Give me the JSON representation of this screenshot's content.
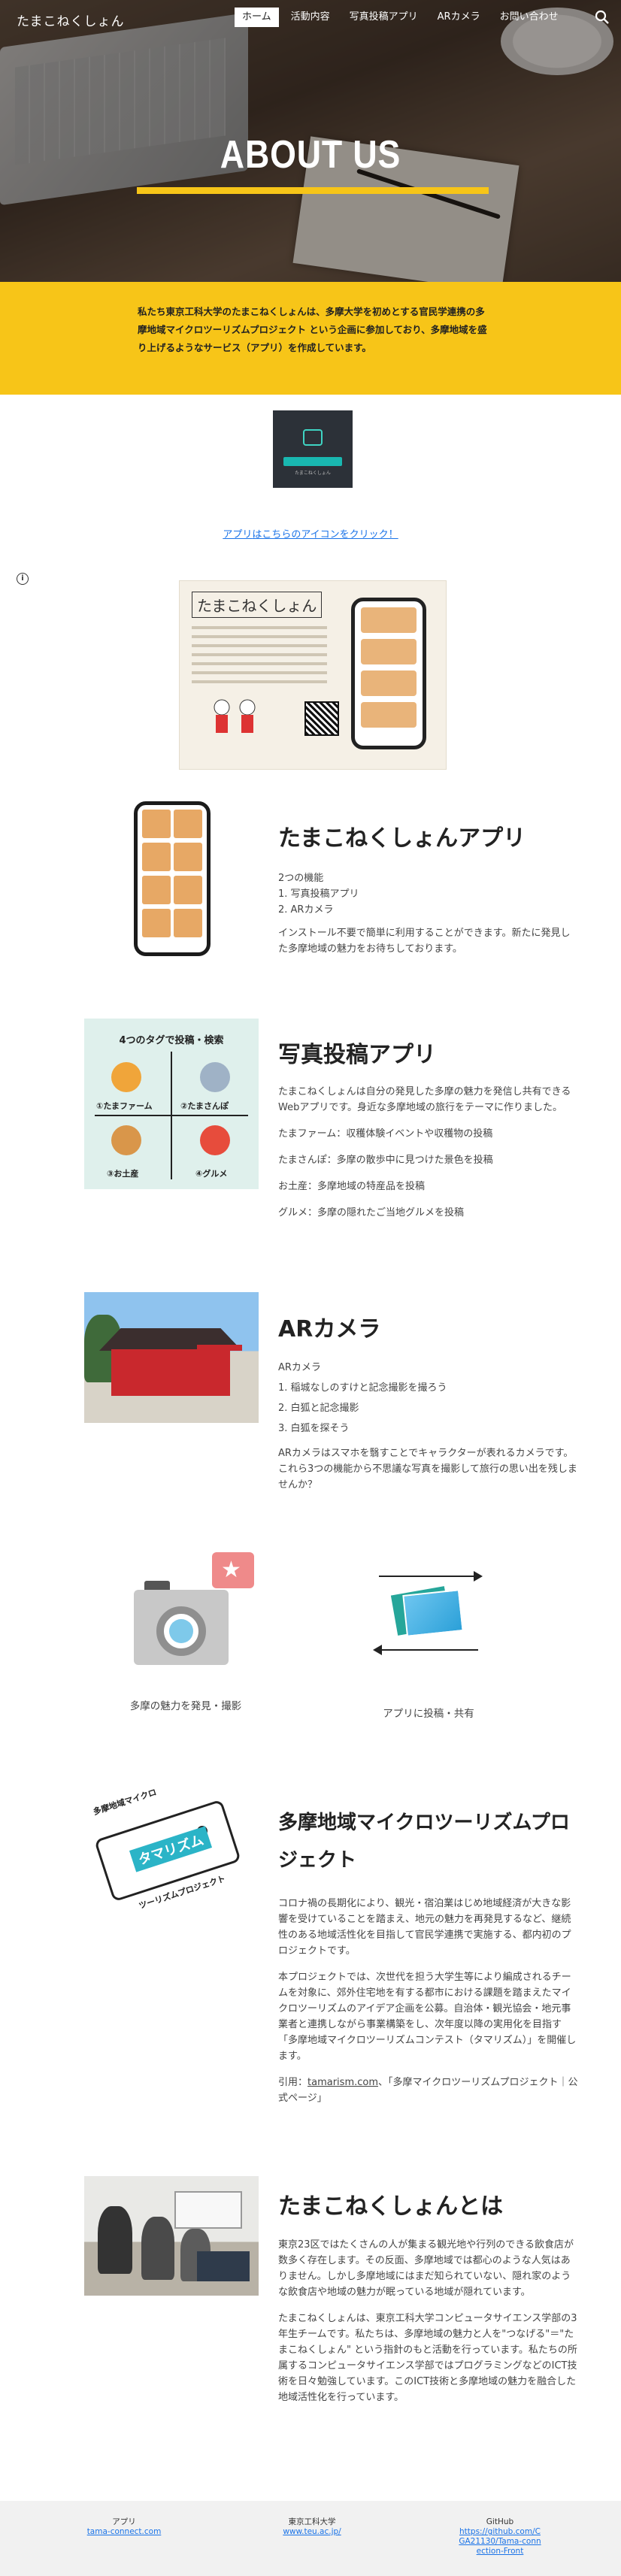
{
  "header": {
    "site_title": "たまこねくしょん",
    "nav": [
      "ホーム",
      "活動内容",
      "写真投稿アプリ",
      "ARカメラ",
      "お問い合わせ"
    ]
  },
  "hero": {
    "title": "ABOUT US"
  },
  "intro": {
    "text": "私たち東京工科大学のたまこねくしょんは、多摩大学を初めとする官民学連携の多摩地域マイクロツーリズムプロジェクト という企画に参加しており、多摩地域を盛り上げるようなサービス（アプリ）を作成しています。"
  },
  "app_icon": {
    "label": "たまこねくしょん"
  },
  "app_link": {
    "underlined": "アプリ",
    "rest": "はこちらのアイコンをクリック！"
  },
  "flyer": {
    "title": "たまこねくしょん"
  },
  "sections": {
    "app": {
      "title": "たまこねくしょんアプリ",
      "lines": [
        "2つの機能",
        "1. 写真投稿アプリ",
        "2. ARカメラ"
      ],
      "desc": "インストール不要で簡単に利用することができます。新たに発見した多摩地域の魅力をお待ちしております。"
    },
    "photo": {
      "title": "写真投稿アプリ",
      "image_title": "4つのタグで投稿・検索",
      "tag_captions": [
        "①たまファーム",
        "②たまさんぽ",
        "③お土産",
        "④グルメ"
      ],
      "paragraphs": [
        "たまこねくしょんは自分の発見した多摩の魅力を発信し共有できるWebアプリです。身近な多摩地域の旅行をテーマに作りました。",
        "たまファーム：収穫体験イベントや収穫物の投稿",
        "たまさんぽ：多摩の散歩中に見つけた景色を投稿",
        "お土産：多摩地域の特産品を投稿",
        "グルメ：多摩の隠れたご当地グルメを投稿"
      ]
    },
    "ar": {
      "title": "ARカメラ",
      "lines": [
        "ARカメラ",
        "1. 稲城なしのすけと記念撮影を撮ろう",
        "2. 白狐と記念撮影",
        "3. 白狐を探そう"
      ],
      "desc": "ARカメラはスマホを翳すことでキャラクターが表れるカメラです。これら3つの機能から不思議な写真を撮影して旅行の思い出を残しませんか？"
    },
    "illustrations": {
      "left_caption": "多摩の魅力を発見・撮影",
      "right_caption": "アプリに投稿・共有"
    },
    "project": {
      "title": "多摩地域マイクロツーリズムプロジェクト",
      "logo_top": "多摩地域マイクロ",
      "logo_main": "タマリズム",
      "logo_bottom": "ツーリズムプロジェクト",
      "paragraphs": [
        "コロナ禍の長期化により、観光・宿泊業はじめ地域経済が大きな影響を受けていることを踏まえ、地元の魅力を再発見するなど、継続性のある地域活性化を目指して官民学連携で実施する、都内初のプロジェクトです。",
        "本プロジェクトでは、次世代を担う大学生等により編成されるチームを対象に、郊外住宅地を有する都市における課題を踏まえたマイクロツーリズムのアイデア企画を公募。自治体・観光協会・地元事業者と連携しながら事業構築をし、次年度以降の実用化を目指す「多摩地域マイクロツーリズムコンテスト（タマリズム）」を開催します。"
      ],
      "cite_prefix": "引用：",
      "cite_link": "tamarism.com",
      "cite_suffix": "、「多摩マイクロツーリズムプロジェクト｜公式ページ」"
    },
    "about": {
      "title": "たまこねくしょんとは",
      "paragraphs": [
        "東京23区ではたくさんの人が集まる観光地や行列のできる飲食店が数多く存在します。その反面、多摩地域では都心のような人気はありません。しかし多摩地域にはまだ知られていない、隠れ家のような飲食店や地域の魅力が眠っている地域が隠れています。",
        "たまこねくしょんは、東京工科大学コンピュータサイエンス学部の3年生チームです。私たちは、多摩地域の魅力と人を\"つなげる\"＝\"たまこねくしょん\" という指針のもと活動を行っています。私たちの所属するコンピュータサイエンス学部ではプログラミングなどのICT技術を日々勉強しています。このICT技術と多摩地域の魅力を融合した地域活性化を行っています。"
      ]
    }
  },
  "footer": {
    "cols": [
      {
        "label": "アプリ",
        "link": "tama-connect.com"
      },
      {
        "label": "東京工科大学",
        "link": "www.teu.ac.jp/"
      },
      {
        "label": "GitHub",
        "link": "https://github.com/CGA21130/Tama-connection-Front"
      }
    ]
  }
}
